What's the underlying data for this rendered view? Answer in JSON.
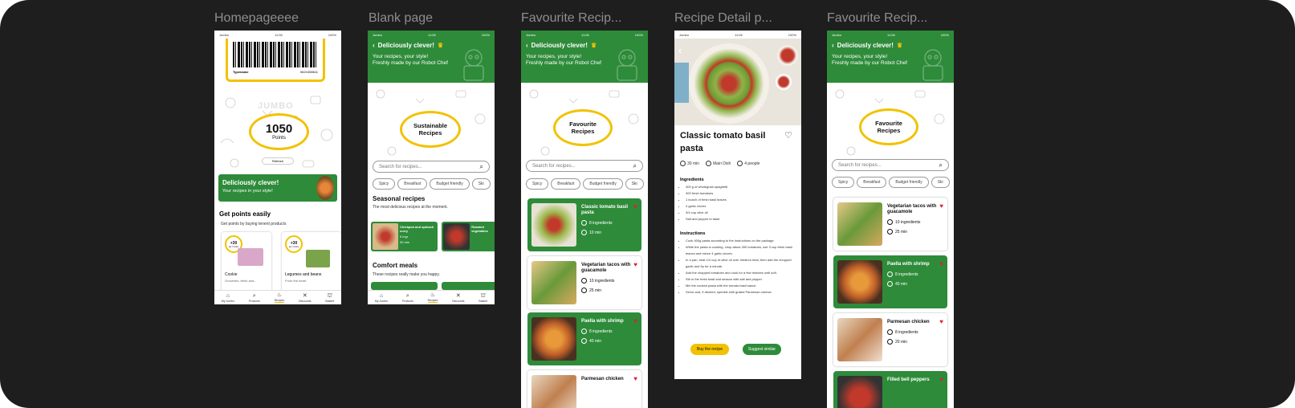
{
  "frames": [
    {
      "title": "Homepageeee"
    },
    {
      "title": "Blank page"
    },
    {
      "title": "Favourite Recip..."
    },
    {
      "title": "Recipe Detail p..."
    },
    {
      "title": "Favourite Recip..."
    }
  ],
  "status_bar": {
    "carrier": "Jumbo",
    "time": "11:06",
    "battery": "100%"
  },
  "colors": {
    "brand_green": "#2e8b3a",
    "brand_yellow": "#f2c200",
    "heart_red": "#e01e37",
    "canvas": "#1e1e1e"
  },
  "home": {
    "card_name": "Typename",
    "card_number": "0621008611",
    "watermark": "JUMBO",
    "points_value": "1050",
    "points_label": "Points",
    "refresh_label": "Refresh",
    "promo_title": "Deliciously clever!",
    "promo_sub": "Your recipes in your style!",
    "section_title": "Get points easily",
    "section_sub": "Get points by buying tenent products",
    "products": [
      {
        "badge": "+30",
        "badge_sub": "per 3 stuks",
        "name": "Cookie",
        "desc": "Groceries, fresh and..."
      },
      {
        "badge": "+30",
        "badge_sub": "per 3 stuks",
        "name": "Legumes and beans",
        "desc": "From the heart"
      }
    ]
  },
  "tabs": [
    {
      "label": "My Jumbo",
      "icon": "home-icon"
    },
    {
      "label": "Products",
      "icon": "search-icon"
    },
    {
      "label": "Recipes",
      "icon": "recipes-icon"
    },
    {
      "label": "Discounts",
      "icon": "discount-icon"
    },
    {
      "label": "Basket",
      "icon": "basket-icon"
    }
  ],
  "banner": {
    "title": "Deliciously clever!",
    "line1": "Your recipes, your style!",
    "line2": "Freshly made by our Robot Chef"
  },
  "blank": {
    "hero_line1": "Sustainable",
    "hero_line2": "Recipes",
    "search_placeholder": "Search for recipes...",
    "filters": [
      "Spicy",
      "Breakfast",
      "Budget friendly",
      "Ski"
    ],
    "seasonal_title": "Seasonal recipes",
    "seasonal_sub": "The most delicious recipes at the moment.",
    "seasonal_cards": [
      {
        "name": "Chickpea and spinach curry",
        "meta1": "6 ingr.",
        "meta2": "30 min"
      },
      {
        "name": "Roasted vegetables",
        "meta1": "",
        "meta2": ""
      }
    ],
    "comfort_title": "Comfort meals",
    "comfort_sub": "These recipes really make you happy."
  },
  "fav": {
    "hero_line1": "Favourite",
    "hero_line2": "Recipes",
    "search_placeholder": "Search for recipes...",
    "filters": [
      "Spicy",
      "Breakfast",
      "Budget friendly",
      "Ski"
    ],
    "recipes": [
      {
        "name": "Classic tomato basil pasta",
        "ingredients": "8 ingredients",
        "time": "10 min"
      },
      {
        "name": "Vegetarian tacos with guacamole",
        "ingredients": "10 ingredients",
        "time": "25 min"
      },
      {
        "name": "Paella with shrimp",
        "ingredients": "8 ingredients",
        "time": "40 min"
      },
      {
        "name": "Parmesan chicken",
        "ingredients": "",
        "time": ""
      }
    ]
  },
  "detail": {
    "title": "Classic tomato basil pasta",
    "meta": [
      "30 min",
      "Main Dish",
      "4 people"
    ],
    "ingredients_title": "Ingredients",
    "ingredients": [
      "400 g of wholegrain spaghetti",
      "300 fresh tomatoes",
      "1 bunch of fresh basil leaves",
      "4 garlic cloves",
      "3/4 cup olive oil",
      "Salt and pepper to taste"
    ],
    "instructions_title": "Instructions",
    "instructions": [
      "Cook 400g pasta according to the instructions on the package.",
      "While the pasta is cooking, chop about 300 tomatoes, use 3 cup fresh basil leaves and mince 4 garlic cloves.",
      "In a pan, heat 1/4 cup of olive oil over medium heat, then add the chopped garlic and fry for a minute.",
      "Add the chopped tomatoes and cook for a few minutes until soft.",
      "Stir in the fresh basil and season with salt and pepper.",
      "Mix the cooked pasta with the tomato-basil sauce.",
      "Serve and, if desired, sprinkle with grated Parmesan cheese."
    ],
    "buy_button": "Buy the recipe",
    "suggest_button": "Suggest similar"
  },
  "fav2": {
    "hero_line1": "Favourite",
    "hero_line2": "Recipes",
    "search_placeholder": "Search for recipes...",
    "filters": [
      "Spicy",
      "Breakfast",
      "Budget friendly",
      "Ski"
    ],
    "recipes": [
      {
        "name": "Vegetarian tacos with guacamole",
        "ingredients": "10 ingredients",
        "time": "25 min"
      },
      {
        "name": "Paella with shrimp",
        "ingredients": "8 ingredients",
        "time": "40 min"
      },
      {
        "name": "Parmesan chicken",
        "ingredients": "8 ingredients",
        "time": "20 min"
      },
      {
        "name": "Filled bell peppers",
        "ingredients": "",
        "time": ""
      }
    ]
  }
}
